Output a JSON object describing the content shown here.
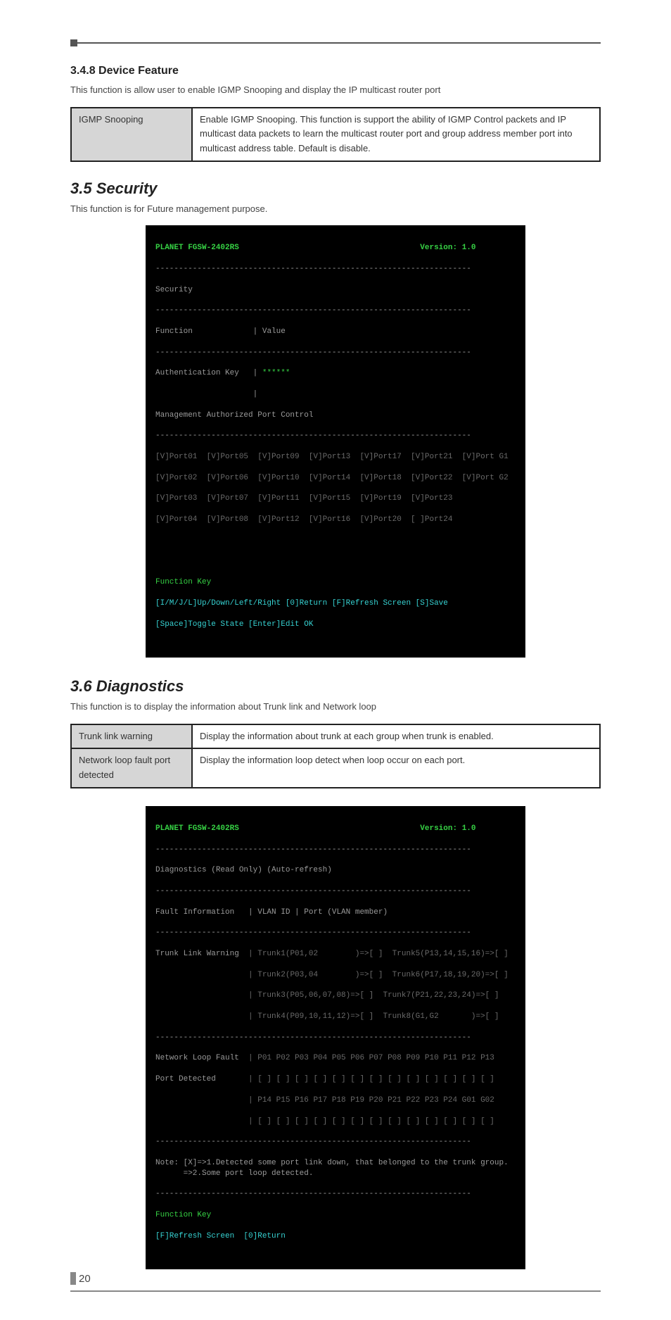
{
  "section348": {
    "heading": "3.4.8 Device Feature",
    "intro": "This function is allow user to enable IGMP Snooping and display the IP multicast router port",
    "table": {
      "rows": [
        {
          "name": "IGMP Snooping",
          "desc": "Enable IGMP Snooping. This function is support the ability of IGMP Control packets and IP multicast data packets to learn the multicast router port and group address member port into multicast address table. Default is disable."
        }
      ]
    }
  },
  "section35": {
    "heading": "3.5 Security",
    "intro": "This function is for Future management purpose.",
    "terminal": {
      "title": "PLANET FGSW-2402RS",
      "version": "Version: 1.0",
      "menu": "Security",
      "func_label": "Function",
      "value_label": "Value",
      "auth_key_label": "Authentication Key",
      "auth_key_value": "******",
      "mgmt_header": "Management Authorized Port Control",
      "ports_line1": "[V]Port01  [V]Port05  [V]Port09  [V]Port13  [V]Port17  [V]Port21  [V]Port G1",
      "ports_line2": "[V]Port02  [V]Port06  [V]Port10  [V]Port14  [V]Port18  [V]Port22  [V]Port G2",
      "ports_line3": "[V]Port03  [V]Port07  [V]Port11  [V]Port15  [V]Port19  [V]Port23",
      "ports_line4": "[V]Port04  [V]Port08  [V]Port12  [V]Port16  [V]Port20  [ ]Port24",
      "fkey": "Function Key",
      "fhelp1": "[I/M/J/L]Up/Down/Left/Right [0]Return [F]Refresh Screen [S]Save",
      "fhelp2": "[Space]Toggle State [Enter]Edit OK"
    }
  },
  "section36": {
    "heading": "3.6 Diagnostics",
    "intro": "This function is to display the information about Trunk link and Network loop",
    "table": {
      "rows": [
        {
          "name": "Trunk link warning",
          "desc": "Display the information about trunk at each group when trunk is enabled."
        },
        {
          "name": "Network loop fault port detected",
          "desc": "Display the information loop detect when loop occur on each port."
        }
      ]
    },
    "terminal": {
      "title": "PLANET FGSW-2402RS",
      "version": "Version: 1.0",
      "mode": "Diagnostics (Read Only) (Auto-refresh)",
      "fault_info_label": "Fault Information",
      "fault_info_value": "| VLAN ID | Port (VLAN member)",
      "trunk_warn_label": "Trunk Link Warning",
      "trunk_line1": "| Trunk1(P01,02        )=>[ ]  Trunk5(P13,14,15,16)=>[ ]",
      "trunk_line2": "| Trunk2(P03,04        )=>[ ]  Trunk6(P17,18,19,20)=>[ ]",
      "trunk_line3": "| Trunk3(P05,06,07,08)=>[ ]  Trunk7(P21,22,23,24)=>[ ]",
      "trunk_line4": "| Trunk4(P09,10,11,12)=>[ ]  Trunk8(G1,G2       )=>[ ]",
      "loop_label": "Network Loop Fault\nPort Detected",
      "loop_line1": "| P01 P02 P03 P04 P05 P06 P07 P08 P09 P10 P11 P12 P13",
      "loop_line2": "| [ ] [ ] [ ] [ ] [ ] [ ] [ ] [ ] [ ] [ ] [ ] [ ] [ ]",
      "loop_line3": "| P14 P15 P16 P17 P18 P19 P20 P21 P22 P23 P24 G01 G02",
      "loop_line4": "| [ ] [ ] [ ] [ ] [ ] [ ] [ ] [ ] [ ] [ ] [ ] [ ] [ ]",
      "note": "Note: [X]=>1.Detected some port link down, that belonged to the trunk group.\n      =>2.Some port loop detected.",
      "fkey": "Function Key",
      "fhelp": "[F]Refresh Screen  [0]Return"
    }
  },
  "page_number": "20"
}
